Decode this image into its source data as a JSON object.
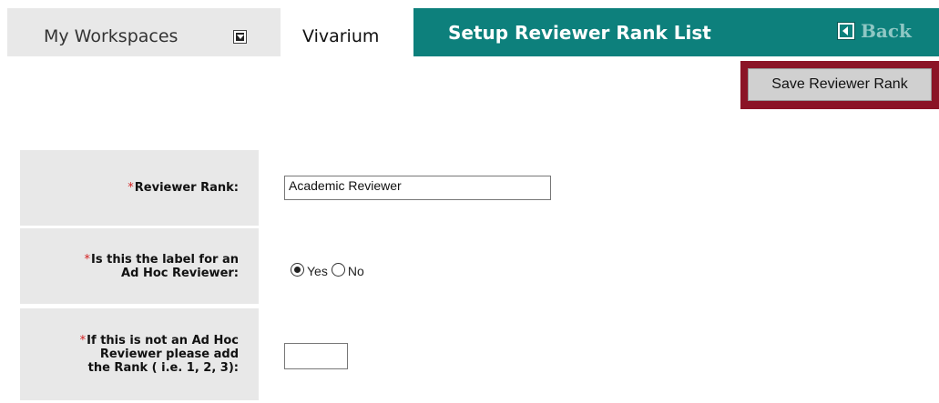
{
  "nav": {
    "workspaces_label": "My Workspaces",
    "site_label": "Vivarium",
    "page_title": "Setup Reviewer Rank List",
    "back_label": "Back"
  },
  "toolbar": {
    "save_label": "Save Reviewer Rank"
  },
  "form": {
    "required_marker": "*",
    "reviewer_rank": {
      "label": "Reviewer Rank:",
      "value": "Academic Reviewer"
    },
    "ad_hoc": {
      "label_line1": "Is this the label for an",
      "label_line2": "Ad Hoc Reviewer:",
      "options": [
        "Yes",
        "No"
      ],
      "selected": "Yes"
    },
    "rank_number": {
      "label_line1": "If this is not an Ad Hoc",
      "label_line2": "Reviewer please add",
      "label_line3": "the Rank ( i.e. 1, 2, 3):",
      "value": ""
    }
  },
  "colors": {
    "title_bar": "#0d807c",
    "save_frame": "#8b1426",
    "required": "#d42020",
    "label_bg": "#e8e8e8"
  }
}
